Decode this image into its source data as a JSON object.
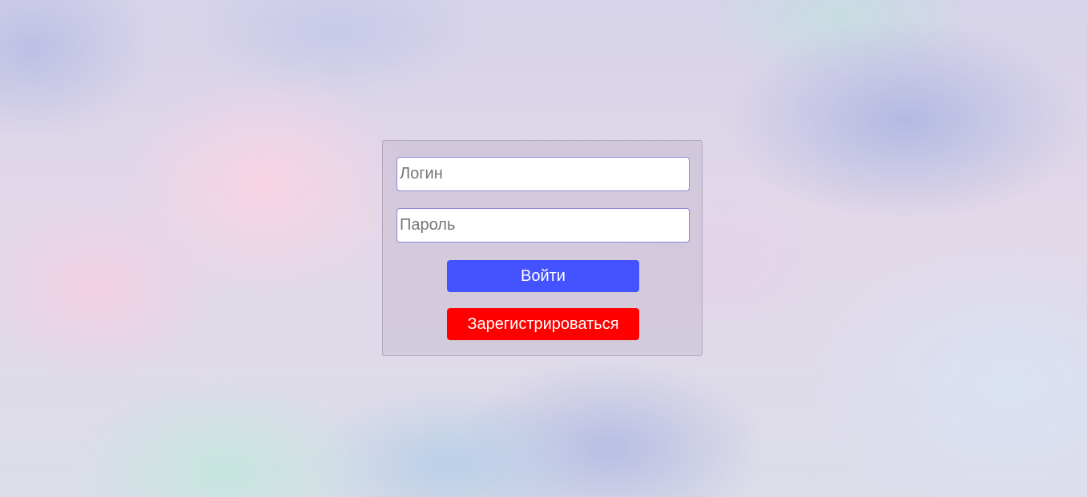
{
  "form": {
    "login_field": {
      "value": "",
      "placeholder": "Логин"
    },
    "password_field": {
      "value": "",
      "placeholder": "Пароль"
    },
    "login_button": {
      "label": "Войти",
      "color": "#4452ff"
    },
    "register_button": {
      "label": "Зарегистрироваться",
      "color": "#ff0000"
    }
  }
}
